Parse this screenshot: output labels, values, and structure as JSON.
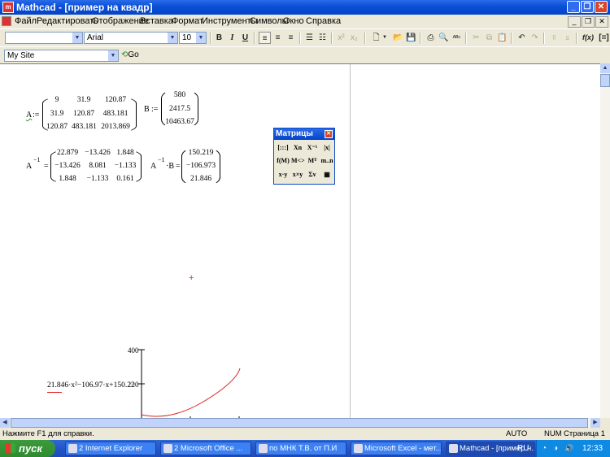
{
  "window": {
    "title": "Mathcad - [пример на квадр]",
    "app_icon": "mathcad-icon",
    "buttons": [
      "minimize-icon",
      "restore-icon",
      "close-icon"
    ]
  },
  "menu": {
    "items": [
      "Файл",
      "Редактировать",
      "Отображение",
      "Вставка",
      "Формат",
      "Инструменты",
      "Символы",
      "Окно",
      "Справка"
    ]
  },
  "format_toolbar": {
    "style_value": "",
    "font_value": "Arial",
    "size_value": "10",
    "bold": "B",
    "italic": "I",
    "underline": "U"
  },
  "address_bar": {
    "value": "My Site",
    "go_label": "Go"
  },
  "worksheet": {
    "A_name": "A",
    "assign": ":=",
    "A_matrix": [
      [
        "9",
        "31.9",
        "120.87"
      ],
      [
        "31.9",
        "120.87",
        "483.181"
      ],
      [
        "120.87",
        "483.181",
        "2013.869"
      ]
    ],
    "B_name": "B",
    "B_matrix": [
      "580",
      "2417.5",
      "10463.67"
    ],
    "Ainv_label": "A",
    "inv_exp": "−1",
    "equals": "=",
    "Ainv_matrix": [
      [
        "22.879",
        "−13.426",
        "1.848"
      ],
      [
        "−13.426",
        "8.081",
        "−1.133"
      ],
      [
        "1.848",
        "−1.133",
        "0.161"
      ]
    ],
    "AinvB_label": "A",
    "AinvB_dot": "·B",
    "AinvB_matrix": [
      "150.219",
      "−106.973",
      "21.846"
    ],
    "plot_expression": "21.846·x²−106.97·x+150.22",
    "plot_ticks": [
      "400",
      "200"
    ]
  },
  "palette": {
    "title": "Матрицы",
    "buttons": [
      "[:::]",
      "Xn",
      "X⁻¹",
      "|x|",
      "f(M)",
      "M<>",
      "Mᵀ",
      "m..n",
      "x·y",
      "x×y",
      "Σv",
      "▦"
    ]
  },
  "status": {
    "help": "Нажмите F1 для справки.",
    "mode": "AUTO",
    "num": "NUM",
    "page": "Страница 1"
  },
  "taskbar": {
    "start_label": "пуск",
    "tasks": [
      "2 Internet Explorer",
      "2 Microsoft Office ...",
      "по МНК Т.В. от П.И",
      "Microsoft Excel - мет...",
      "Mathcad - [пример н..."
    ],
    "lang": "RU",
    "time": "12:33"
  },
  "colors": {
    "title_blue": "#0a4fd6",
    "plot_curve": "#e02020",
    "start_green": "#2f8b2f"
  }
}
